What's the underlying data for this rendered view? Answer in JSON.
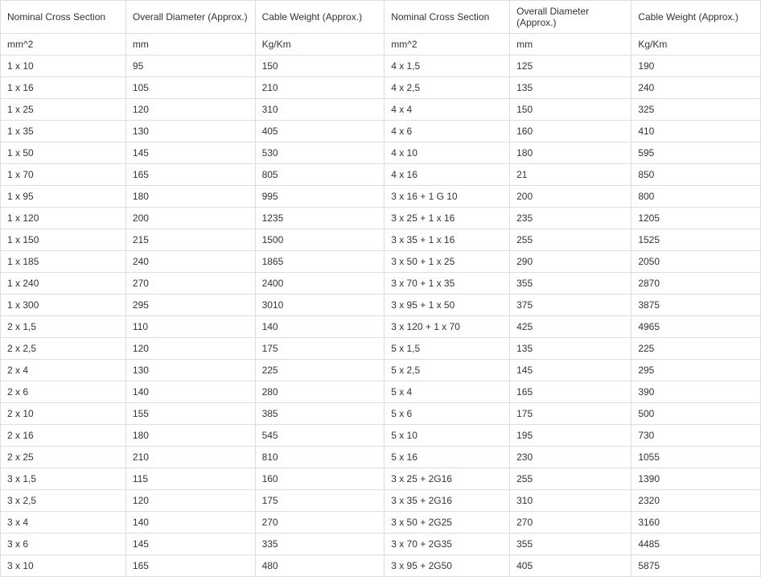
{
  "headers": [
    "Nominal Cross Section",
    "Overall Diameter (Approx.)",
    "Cable Weight (Approx.)",
    "Nominal Cross Section",
    "Overall Diameter (Approx.)",
    "Cable Weight (Approx.)"
  ],
  "units": [
    "mm^2",
    "mm",
    "Kg/Km",
    "mm^2",
    "mm",
    "Kg/Km"
  ],
  "rows": [
    [
      "1 x 10",
      "95",
      "150",
      "4 x 1,5",
      "125",
      "190"
    ],
    [
      "1 x 16",
      "105",
      "210",
      "4 x 2,5",
      "135",
      "240"
    ],
    [
      "1 x 25",
      "120",
      "310",
      "4 x 4",
      "150",
      "325"
    ],
    [
      "1 x 35",
      "130",
      "405",
      "4 x 6",
      "160",
      "410"
    ],
    [
      "1 x 50",
      "145",
      "530",
      "4 x 10",
      "180",
      "595"
    ],
    [
      "1 x 70",
      "165",
      "805",
      "4 x 16",
      "21",
      "850"
    ],
    [
      "1 x 95",
      "180",
      "995",
      "3 x 16 + 1 G 10",
      "200",
      "800"
    ],
    [
      "1 x 120",
      "200",
      "1235",
      "3 x 25 + 1 x 16",
      "235",
      "1205"
    ],
    [
      "1 x 150",
      "215",
      "1500",
      "3 x 35 + 1 x 16",
      "255",
      "1525"
    ],
    [
      "1 x 185",
      "240",
      "1865",
      "3 x 50 + 1 x 25",
      "290",
      "2050"
    ],
    [
      "1 x 240",
      "270",
      "2400",
      "3 x 70 + 1 x 35",
      "355",
      "2870"
    ],
    [
      "1 x 300",
      "295",
      "3010",
      "3 x 95 + 1 x 50",
      "375",
      "3875"
    ],
    [
      "2 x 1,5",
      "110",
      "140",
      "3 x 120 + 1 x 70",
      "425",
      "4965"
    ],
    [
      "2 x 2,5",
      "120",
      "175",
      "5 x 1,5",
      "135",
      "225"
    ],
    [
      "2 x 4",
      "130",
      "225",
      "5 x 2,5",
      "145",
      "295"
    ],
    [
      "2 x 6",
      "140",
      "280",
      "5 x 4",
      "165",
      "390"
    ],
    [
      "2 x 10",
      "155",
      "385",
      "5 x 6",
      "175",
      "500"
    ],
    [
      "2 x 16",
      "180",
      "545",
      "5 x 10",
      "195",
      "730"
    ],
    [
      "2 x 25",
      "210",
      "810",
      "5 x 16",
      "230",
      "1055"
    ],
    [
      "3 x 1,5",
      "115",
      "160",
      "3 x 25 + 2G16",
      "255",
      "1390"
    ],
    [
      "3 x 2,5",
      "120",
      "175",
      "3 x 35 + 2G16",
      "310",
      "2320"
    ],
    [
      "3 x 4",
      "140",
      "270",
      "3 x 50 + 2G25",
      "270",
      "3160"
    ],
    [
      "3 x 6",
      "145",
      "335",
      "3 x 70 + 2G35",
      "355",
      "4485"
    ],
    [
      "3 x 10",
      "165",
      "480",
      "3 x 95 + 2G50",
      "405",
      "5875"
    ]
  ]
}
